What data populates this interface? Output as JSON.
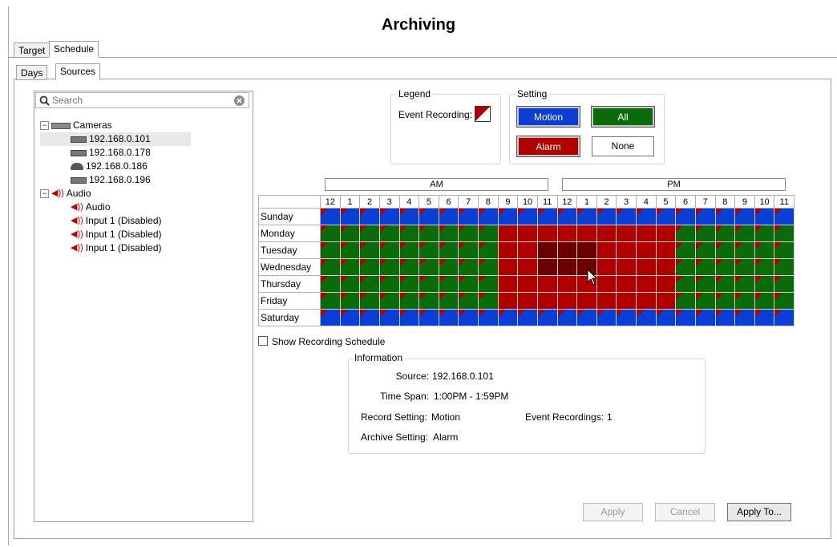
{
  "title": "Archiving",
  "main_tabs": [
    "Target",
    "Schedule"
  ],
  "sub_tabs": [
    "Days",
    "Sources"
  ],
  "search": {
    "placeholder": "Search"
  },
  "tree": {
    "cameras_label": "Cameras",
    "cameras": [
      "192.168.0.101",
      "192.168.0.178",
      "192.168.0.186",
      "192.168.0.196"
    ],
    "audio_label": "Audio",
    "audio_items": [
      "Audio",
      "Input 1 (Disabled)",
      "Input 1 (Disabled)",
      "Input 1 (Disabled)"
    ]
  },
  "legend": {
    "title": "Legend",
    "event_recording_label": "Event Recording:"
  },
  "setting": {
    "title": "Setting",
    "buttons": {
      "motion": "Motion",
      "all": "All",
      "alarm": "Alarm",
      "none": "None"
    }
  },
  "schedule": {
    "am_label": "AM",
    "pm_label": "PM",
    "hours": [
      "12",
      "1",
      "2",
      "3",
      "4",
      "5",
      "6",
      "7",
      "8",
      "9",
      "10",
      "11",
      "12",
      "1",
      "2",
      "3",
      "4",
      "5",
      "6",
      "7",
      "8",
      "9",
      "10",
      "11"
    ],
    "days": [
      "Sunday",
      "Monday",
      "Tuesday",
      "Wednesday",
      "Thursday",
      "Friday",
      "Saturday"
    ],
    "rows": [
      "BBBBBBBBBBBBBBBBBBBBBBBB",
      "GGGGGGGGGRRRRRRRRRGGGGGG",
      "GGGGGGGGGRRDDDRRRRGGGGGG",
      "GGGGGGGGGRRDDDRRRRGGGGGG",
      "GGGGGGGGGRRRRRRRRRGGGGGG",
      "GGGGGGGGGRRRRRRRRRGGGGGG",
      "BBBBBBBBBBBBBBBBBBBBBBBB"
    ],
    "flag_rows": [
      "FFFFFFFFFFFFFFFFFFFFFFFF",
      "FFFFFFFFF.........FFFFFF",
      "FFFFFFFFF.........FFFFFF",
      "FFFFFFFFF.........FFFFFF",
      "FFFFFFFFF.........FFFFFF",
      "FFFFFFFFF.........FFFFFF",
      "FFFFFFFFFFFFFFFFFFFFFFFF"
    ],
    "colors": {
      "B": "#0a3fd6",
      "G": "#0a6b0a",
      "R": "#b00000",
      "D": "#6b0000"
    }
  },
  "show_recording_schedule": "Show Recording Schedule",
  "information": {
    "title": "Information",
    "source_label": "Source:",
    "source_value": "192.168.0.101",
    "time_span_label": "Time Span:",
    "time_span_value": "1:00PM - 1:59PM",
    "record_setting_label": "Record Setting:",
    "record_setting_value": "Motion",
    "event_recordings_label": "Event Recordings:",
    "event_recordings_value": "1",
    "archive_setting_label": "Archive Setting:",
    "archive_setting_value": "Alarm"
  },
  "footer": {
    "apply": "Apply",
    "cancel": "Cancel",
    "apply_to": "Apply To..."
  }
}
